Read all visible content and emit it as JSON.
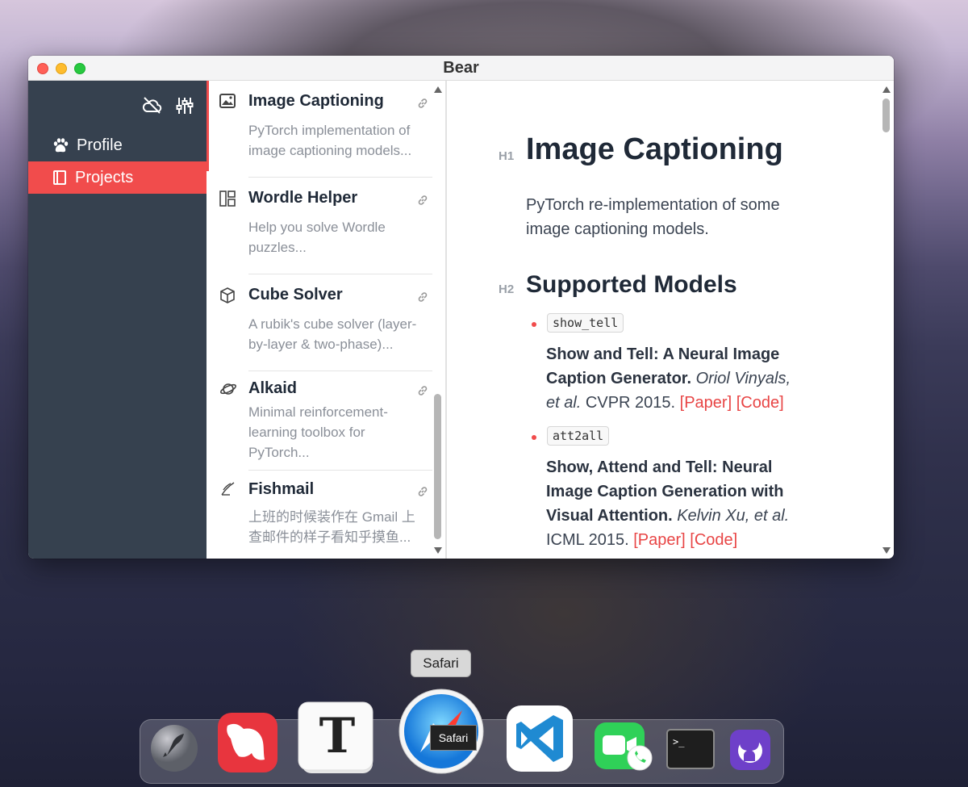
{
  "window": {
    "title": "Bear"
  },
  "sidebar": {
    "items": [
      {
        "label": "Profile",
        "icon": "paw-icon",
        "active": false
      },
      {
        "label": "Projects",
        "icon": "book-icon",
        "active": true
      }
    ]
  },
  "notes": [
    {
      "title": "Image Captioning",
      "preview": "PyTorch implementation of image captioning models...",
      "icon": "image-icon"
    },
    {
      "title": "Wordle Helper",
      "preview": "Help you solve Wordle puzzles...",
      "icon": "layout-icon"
    },
    {
      "title": "Cube Solver",
      "preview": "A rubik's cube solver (layer-by-layer & two-phase)...",
      "icon": "cube-icon"
    },
    {
      "title": "Alkaid",
      "preview": "Minimal reinforcement-learning toolbox for PyTorch...",
      "icon": "orbit-icon"
    },
    {
      "title": "Fishmail",
      "preview": "上班的时候装作在 Gmail 上查邮件的样子看知乎摸鱼...",
      "icon": "feather-icon"
    }
  ],
  "editor": {
    "h1_label": "H1",
    "h1": "Image Captioning",
    "intro": "PyTorch re-implementation of some image captioning models.",
    "h2_label": "H2",
    "h2": "Supported Models",
    "models": [
      {
        "code": "show_tell",
        "title": "Show and Tell: A Neural Image Caption Generator.",
        "authors": "Oriol Vinyals, et al.",
        "venue": "CVPR 2015.",
        "paper": "[Paper]",
        "code_link": "[Code]"
      },
      {
        "code": "att2all",
        "title": "Show, Attend and Tell: Neural Image Caption Generation with Visual Attention.",
        "authors": "Kelvin Xu, et al.",
        "venue": "ICML 2015.",
        "paper": "[Paper]",
        "code_link": "[Code]"
      }
    ]
  },
  "dock": {
    "tooltip": "Safari",
    "apps": [
      "Launchpad",
      "Bear",
      "Typora",
      "Safari",
      "Visual Studio Code",
      "FaceTime",
      "Terminal",
      "GitHub Desktop"
    ]
  },
  "colors": {
    "accent": "#f14c4c",
    "sidebar": "#36414f"
  }
}
